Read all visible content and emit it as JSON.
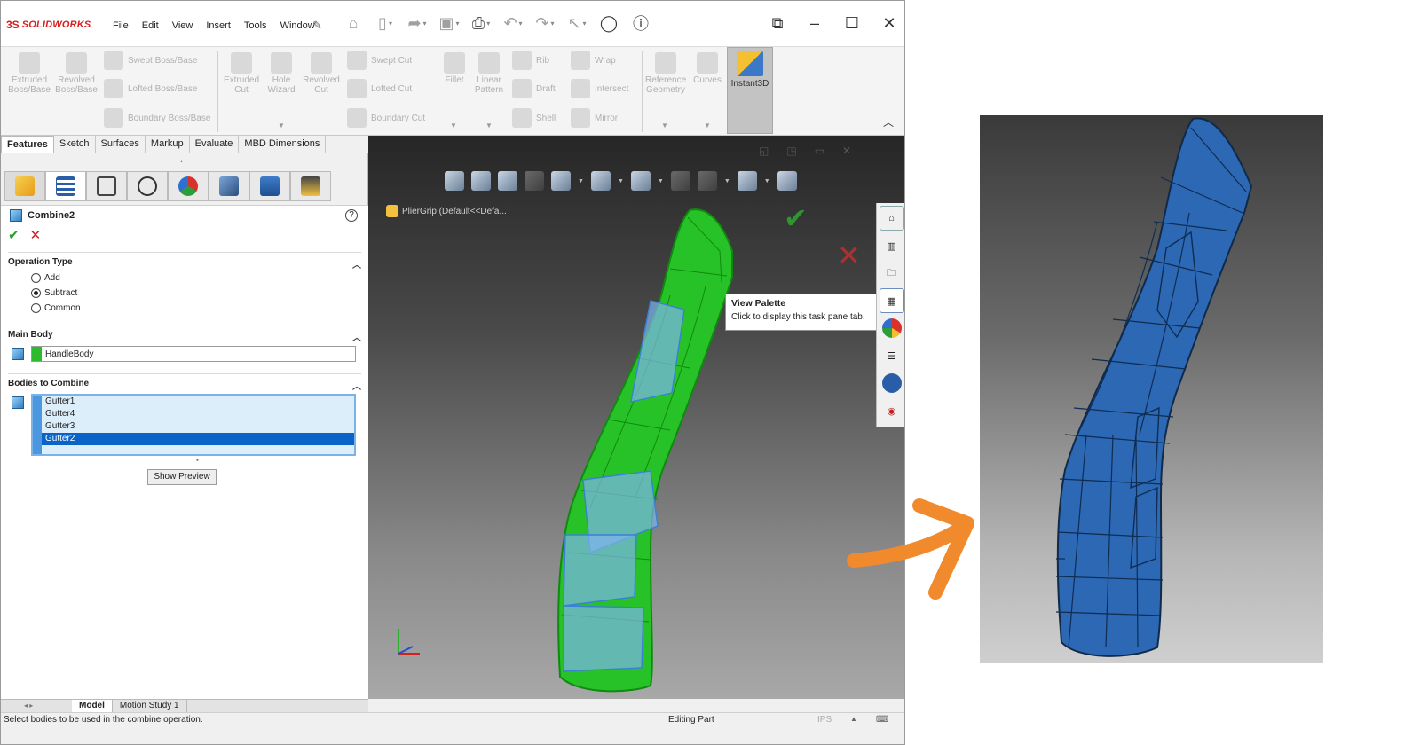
{
  "app": {
    "logo_ds": "3S",
    "logo_brand": "SOLIDWORKS",
    "menu": [
      "File",
      "Edit",
      "View",
      "Insert",
      "Tools",
      "Window"
    ]
  },
  "command_manager": {
    "group1": [
      {
        "label": "Extruded Boss/Base"
      },
      {
        "label": "Revolved Boss/Base"
      },
      {
        "label": "Swept Boss/Base"
      },
      {
        "label": "Lofted Boss/Base"
      },
      {
        "label": "Boundary Boss/Base"
      }
    ],
    "group2": [
      {
        "label": "Extruded Cut"
      },
      {
        "label": "Hole Wizard"
      },
      {
        "label": "Revolved Cut"
      },
      {
        "label": "Swept Cut"
      },
      {
        "label": "Lofted Cut"
      },
      {
        "label": "Boundary Cut"
      }
    ],
    "group3": [
      {
        "label": "Fillet"
      },
      {
        "label": "Linear Pattern"
      },
      {
        "label": "Rib"
      },
      {
        "label": "Draft"
      },
      {
        "label": "Shell"
      },
      {
        "label": "Wrap"
      },
      {
        "label": "Intersect"
      },
      {
        "label": "Mirror"
      }
    ],
    "group4": [
      {
        "label": "Reference Geometry"
      },
      {
        "label": "Curves"
      }
    ],
    "instant3d": "Instant3D"
  },
  "tabs": [
    "Features",
    "Sketch",
    "Surfaces",
    "Markup",
    "Evaluate",
    "MBD Dimensions"
  ],
  "property_manager": {
    "title": "Combine2",
    "help": "?",
    "ok": "✔",
    "cancel": "✕",
    "operation_type": {
      "header": "Operation Type",
      "options": [
        {
          "label": "Add",
          "selected": false
        },
        {
          "label": "Subtract",
          "selected": true
        },
        {
          "label": "Common",
          "selected": false
        }
      ]
    },
    "main_body": {
      "header": "Main Body",
      "value": "HandleBody"
    },
    "bodies_to_combine": {
      "header": "Bodies to Combine",
      "items": [
        "Gutter1",
        "Gutter4",
        "Gutter3",
        "Gutter2"
      ],
      "selected_index": 3
    },
    "preview_button": "Show Preview"
  },
  "viewport": {
    "tree_flyout": "PlierGrip  (Default<<Defa...",
    "tooltip_title": "View Palette",
    "tooltip_text": "Click to display this task pane tab."
  },
  "bottom_tabs": [
    "Model",
    "Motion Study 1"
  ],
  "status": {
    "message": "Select bodies to be used in the combine operation.",
    "mode": "Editing Part",
    "units": "IPS"
  },
  "colors": {
    "accent_green": "#2dbb2d",
    "body_blue": "#2c68b4",
    "arrow_orange": "#f08a2c",
    "selection_blue": "#0a64c8"
  }
}
